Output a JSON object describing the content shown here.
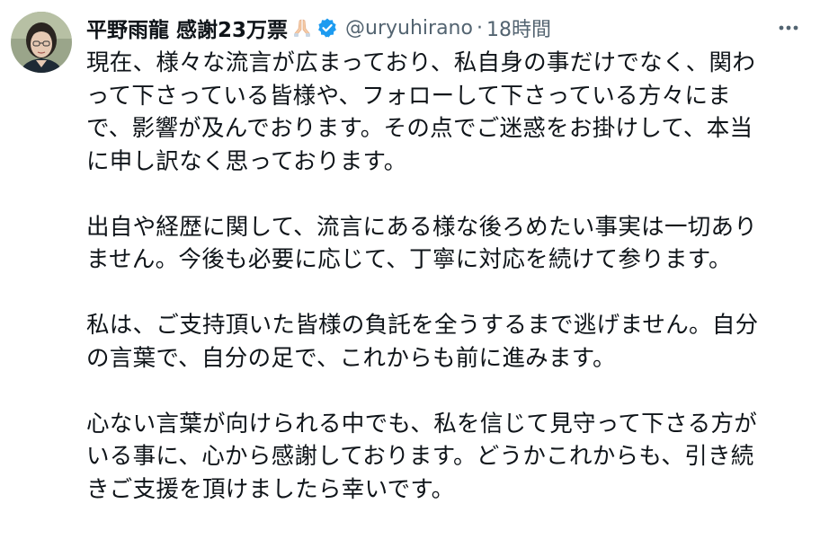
{
  "author": {
    "display_name": "平野雨龍 感謝23万票",
    "emoji": "praying-hands",
    "verified": true,
    "handle": "@uryuhirano",
    "separator": "·",
    "time": "18時間"
  },
  "icons": {
    "avatar": "profile-photo",
    "verified": "verified-badge-icon",
    "more": "more-options-icon"
  },
  "colors": {
    "text": "#0f1419",
    "secondary": "#536471",
    "verified_blue": "#1d9bf0"
  },
  "paragraphs": [
    {
      "lines": [
        "現在、様々な流言が広まっており、私自身の事だけでなく、関わ",
        "って下さっている皆様や、フォローして下さっている方々にま",
        "で、影響が及んでおります。その点でご迷惑をお掛けして、本当",
        "に申し訳なく思っております。"
      ]
    },
    {
      "lines": [
        "出自や経歴に関して、流言にある様な後ろめたい事実は一切あり",
        "ません。今後も必要に応じて、丁寧に対応を続けて参ります。"
      ]
    },
    {
      "lines": [
        "私は、ご支持頂いた皆様の負託を全うするまで逃げません。自分",
        "の言葉で、自分の足で、これからも前に進みます。"
      ]
    },
    {
      "lines": [
        "心ない言葉が向けられる中でも、私を信じて見守って下さる方が",
        "いる事に、心から感謝しております。どうかこれからも、引き続",
        "きご支援を頂けましたら幸いです。"
      ]
    }
  ]
}
